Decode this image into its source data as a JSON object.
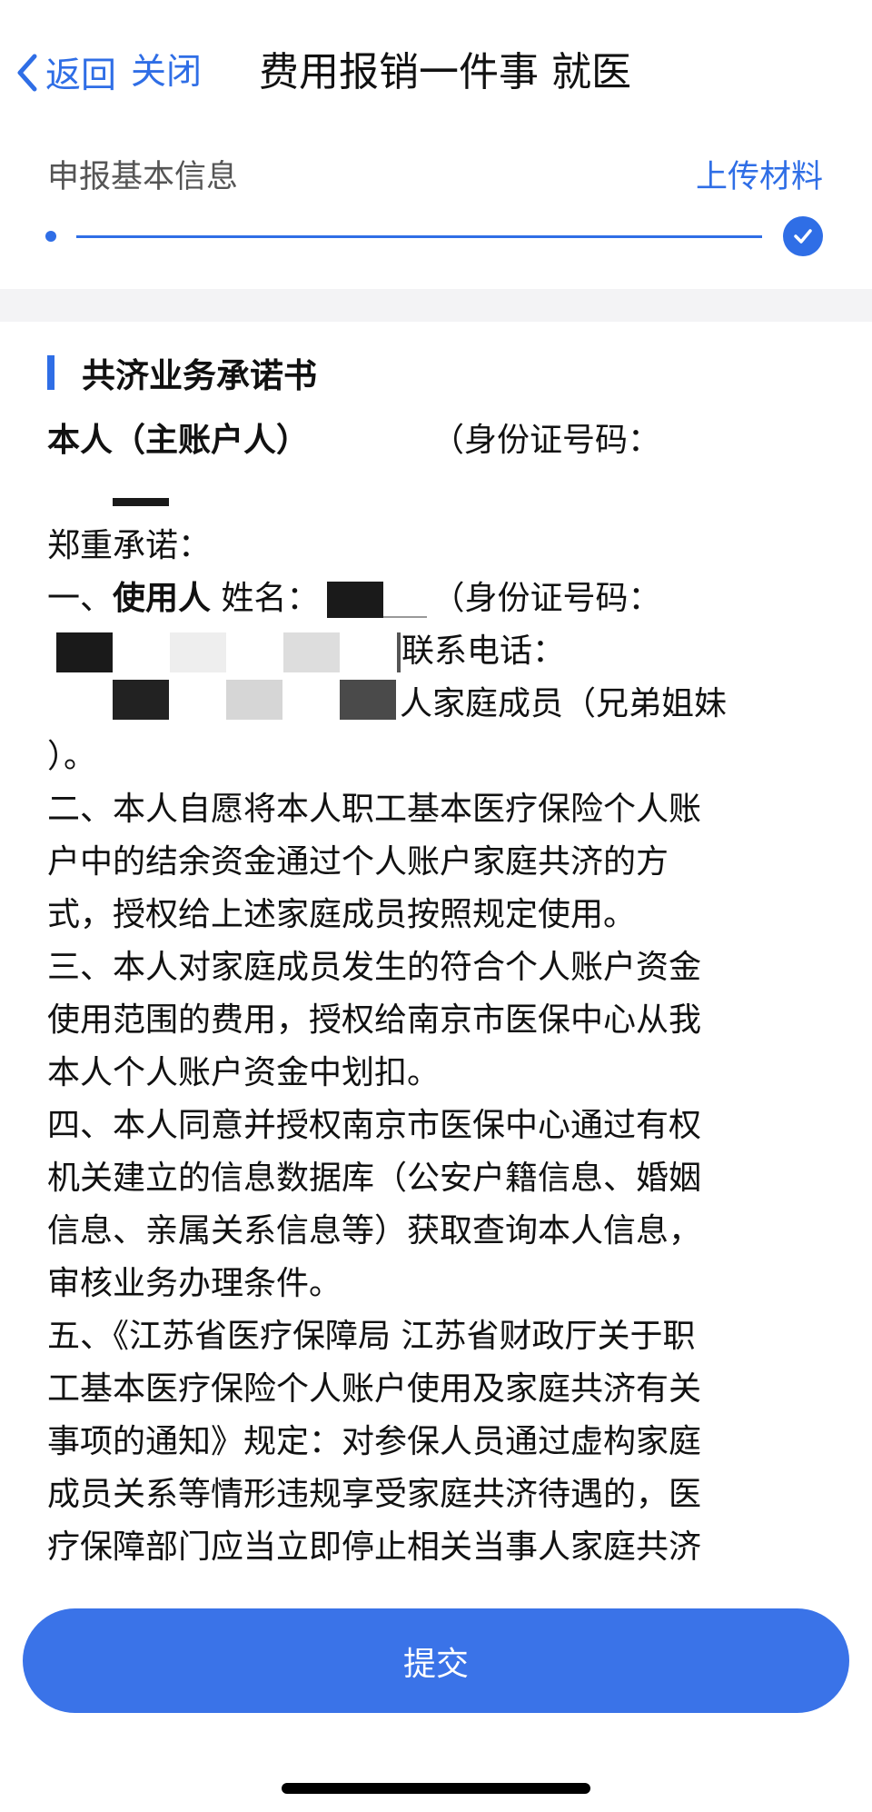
{
  "nav": {
    "back_label": "返回",
    "close_label": "关闭",
    "title": "费用报销一件事  就医"
  },
  "steps": {
    "left_label": "申报基本信息",
    "right_label": "上传材料"
  },
  "section": {
    "title": "共济业务承诺书"
  },
  "doc": {
    "l1a": "本人（主账户人）",
    "l1b": "（身份证号码：",
    "l3": "郑重承诺：",
    "l4a": "一、",
    "l4b": "使用人",
    "l4c": "姓名：",
    "l4d": "（身份证号码：",
    "l5": "联系电话：",
    "l6": "人家庭成员（兄弟姐妹",
    "l7": "）。",
    "p2a": "二、本人自愿将本人职工基本医疗保险个人账",
    "p2b": "户中的结余资金通过个人账户家庭共济的方",
    "p2c": "式，授权给上述家庭成员按照规定使用。",
    "p3a": "三、本人对家庭成员发生的符合个人账户资金",
    "p3b": "使用范围的费用，授权给南京市医保中心从我",
    "p3c": "本人个人账户资金中划扣。",
    "p4a": "四、本人同意并授权南京市医保中心通过有权",
    "p4b": "机关建立的信息数据库（公安户籍信息、婚姻",
    "p4c": "信息、亲属关系信息等）获取查询本人信息，",
    "p4d": "审核业务办理条件。",
    "p5a": "五、《江苏省医疗保障局 江苏省财政厅关于职",
    "p5b": "工基本医疗保险个人账户使用及家庭共济有关",
    "p5c": "事项的通知》规定：对参保人员通过虚构家庭",
    "p5d": "成员关系等情形违规享受家庭共济待遇的，医",
    "p5e": "疗保障部门应当立即停止相关当事人家庭共济"
  },
  "submit_label": "提交",
  "colors": {
    "accent": "#2f6ee6",
    "button": "#3a73e8"
  }
}
